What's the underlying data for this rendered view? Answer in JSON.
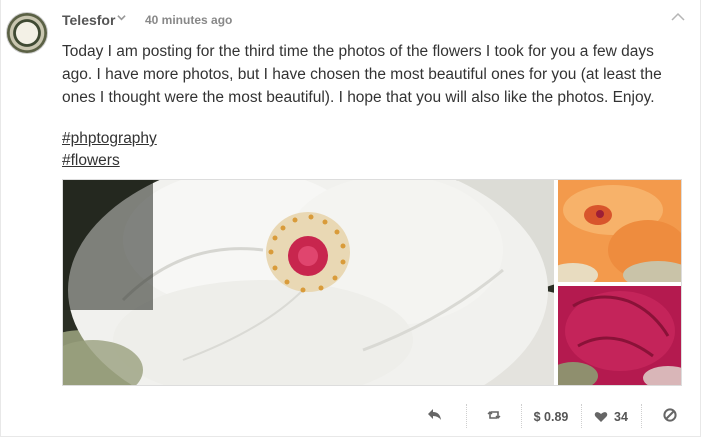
{
  "post": {
    "author": "Telesfor",
    "timestamp": "40 minutes ago",
    "body": "Today I am posting for the third time the photos of the flowers I took for you a few days ago. I have more photos, but I have chosen the most beautiful ones for you (at least the ones I thought were the most beautiful). I hope that you will also like the photos. Enjoy.",
    "tags": [
      "#phptography",
      "#flowers"
    ]
  },
  "actions": {
    "payout": "$ 0.89",
    "likes": "34"
  },
  "icons": {
    "author_menu": "chevron-down-icon",
    "collapse": "chevron-up-icon",
    "reply": "reply-icon",
    "reshare": "reshare-icon",
    "like": "heart-icon",
    "flag": "block-icon"
  },
  "colors": {
    "photo_main_bg": "#e9e9e6",
    "photo_orange": "#f39a4c",
    "photo_pink": "#b41a4f",
    "text": "#333333",
    "muted": "#888888"
  }
}
